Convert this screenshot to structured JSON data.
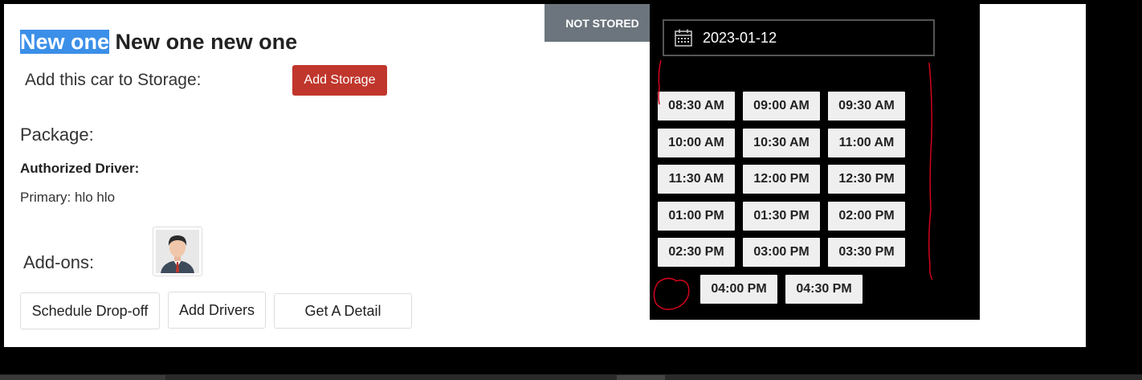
{
  "title": {
    "highlighted": "New one",
    "rest": "New one new one"
  },
  "storage": {
    "label": "Add this car to Storage:",
    "button": "Add Storage"
  },
  "package": {
    "label": "Package:"
  },
  "driver": {
    "heading": "Authorized Driver:",
    "primary": "Primary: hlo hlo"
  },
  "addons": {
    "label": "Add-ons:",
    "avatar_icon": "driver-avatar"
  },
  "actions": {
    "schedule": "Schedule Drop-off",
    "add_drivers": "Add Drivers",
    "detail": "Get A Detail"
  },
  "status": {
    "badge": "NOT STORED",
    "color": "#6c757d"
  },
  "calendar": {
    "date": "2023-01-12",
    "icon": "calendar-icon",
    "slots": [
      "08:30 AM",
      "09:00 AM",
      "09:30 AM",
      "10:00 AM",
      "10:30 AM",
      "11:00 AM",
      "11:30 AM",
      "12:00 PM",
      "12:30 PM",
      "01:00 PM",
      "01:30 PM",
      "02:00 PM",
      "02:30 PM",
      "03:00 PM",
      "03:30 PM",
      "04:00 PM",
      "04:30 PM"
    ]
  },
  "colors": {
    "primary_button": "#c0362c",
    "highlight": "#3b8fe8",
    "annotation": "#d0021b"
  }
}
